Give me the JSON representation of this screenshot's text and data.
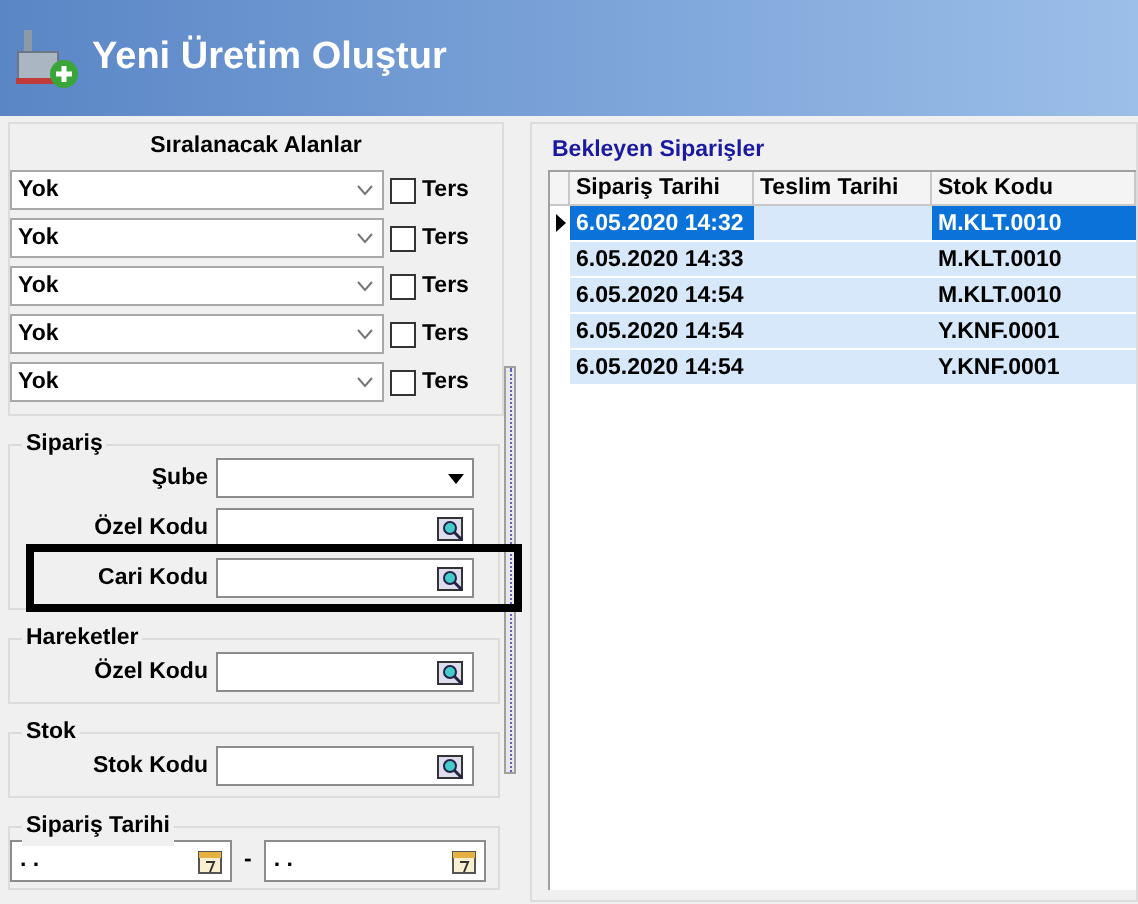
{
  "window": {
    "title": "Yeni Üretim Oluştur"
  },
  "sort_panel": {
    "title": "Sıralanacak Alanlar",
    "rows": [
      {
        "value": "Yok",
        "label": "Ters",
        "checked": false
      },
      {
        "value": "Yok",
        "label": "Ters",
        "checked": false
      },
      {
        "value": "Yok",
        "label": "Ters",
        "checked": false
      },
      {
        "value": "Yok",
        "label": "Ters",
        "checked": false
      },
      {
        "value": "Yok",
        "label": "Ters",
        "checked": false
      }
    ]
  },
  "filter_groups": [
    {
      "title": "Sipariş",
      "fields": [
        {
          "label": "Şube",
          "kind": "dropdown",
          "highlighted": false
        },
        {
          "label": "Özel Kodu",
          "kind": "lookup",
          "highlighted": false
        },
        {
          "label": "Cari Kodu",
          "kind": "lookup",
          "highlighted": true
        }
      ]
    },
    {
      "title": "Hareketler",
      "fields": [
        {
          "label": "Özel Kodu",
          "kind": "lookup",
          "highlighted": false
        }
      ]
    },
    {
      "title": "Stok",
      "fields": [
        {
          "label": "Stok Kodu",
          "kind": "lookup",
          "highlighted": false
        }
      ]
    }
  ],
  "date_range": {
    "title": "Sipariş Tarihi",
    "from": ". .",
    "separator": "-",
    "to": ". ."
  },
  "orders": {
    "title": "Bekleyen Siparişler",
    "columns": [
      "Sipariş Tarihi",
      "Teslim Tarihi",
      "Stok Kodu"
    ],
    "rows": [
      {
        "cells": [
          "6.05.2020 14:32",
          "",
          "M.KLT.0010"
        ],
        "selected": true
      },
      {
        "cells": [
          "6.05.2020 14:33",
          "",
          "M.KLT.0010"
        ],
        "selected": false
      },
      {
        "cells": [
          "6.05.2020 14:54",
          "",
          "M.KLT.0010"
        ],
        "selected": false
      },
      {
        "cells": [
          "6.05.2020 14:54",
          "",
          "Y.KNF.0001"
        ],
        "selected": false
      },
      {
        "cells": [
          "6.05.2020 14:54",
          "",
          "Y.KNF.0001"
        ],
        "selected": false
      }
    ]
  }
}
